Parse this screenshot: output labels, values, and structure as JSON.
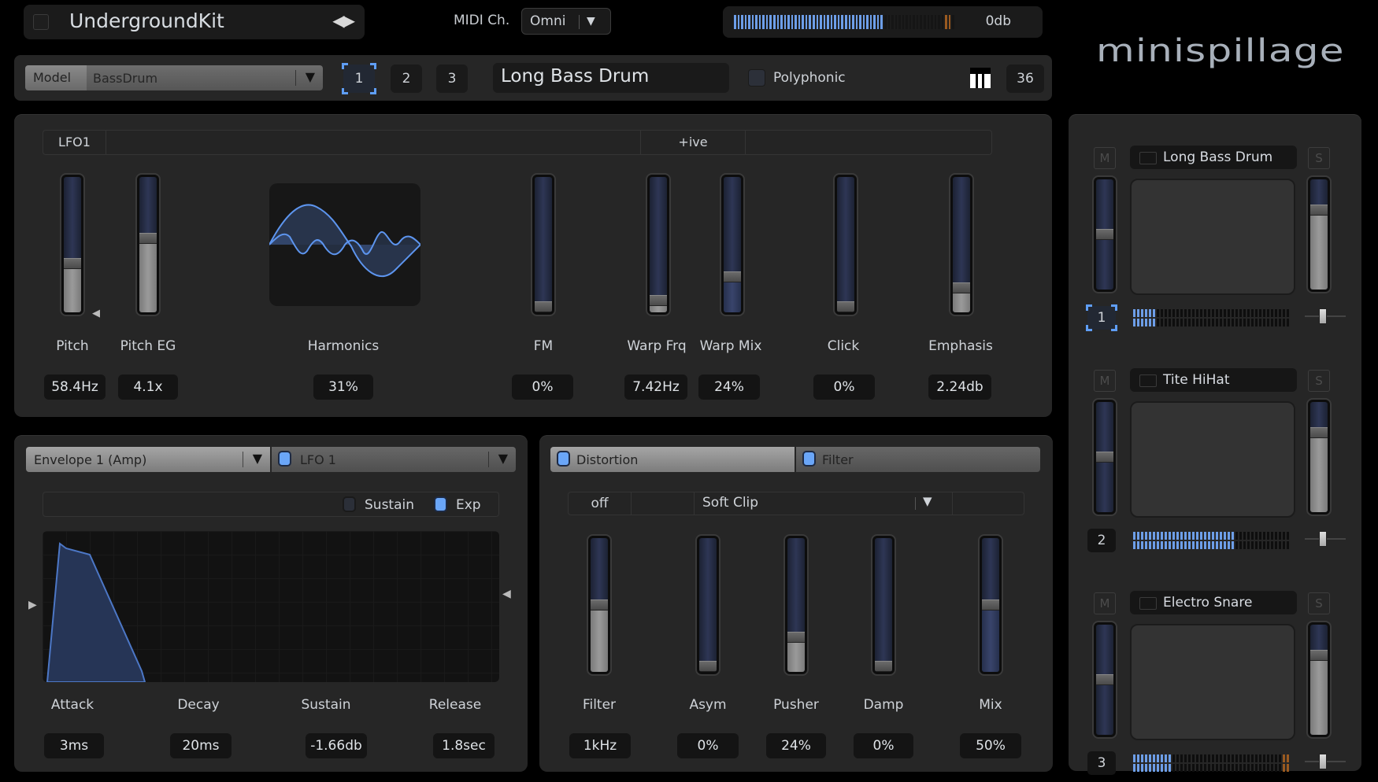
{
  "header": {
    "kit_name": "UndergroundKit",
    "kit_nav_icon": "left-right-arrows",
    "midi_label": "MIDI Ch.",
    "midi_channel": "Omni",
    "master_level": "0db",
    "master_meter_fraction": 0.68,
    "logo": "minispillage"
  },
  "sound": {
    "model_label": "Model",
    "model_value": "BassDrum",
    "slots": [
      "1",
      "2",
      "3"
    ],
    "selected_slot": "1",
    "name": "Long Bass Drum",
    "polyphonic_label": "Polyphonic",
    "polyphonic": false,
    "keyboard_icon": "piano-keys",
    "note": "36"
  },
  "modulation": {
    "source": "LFO1",
    "polarity": "+ive"
  },
  "controls": [
    {
      "label": "Pitch",
      "value": "58.4Hz",
      "level": 0.35
    },
    {
      "label": "Pitch EG",
      "value": "4.1x",
      "level": 0.55
    },
    {
      "label": "Harmonics",
      "value": "31%"
    },
    {
      "label": "FM",
      "value": "0%",
      "level": 0.0
    },
    {
      "label": "Warp Frq",
      "value": "7.42Hz",
      "level": 0.05
    },
    {
      "label": "Warp Mix",
      "value": "24%",
      "level": 0.24
    },
    {
      "label": "Click",
      "value": "0%",
      "level": 0.0
    },
    {
      "label": "Emphasis",
      "value": "2.24db",
      "level": 0.15
    }
  ],
  "envelope": {
    "selector": "Envelope 1 (Amp)",
    "lfo_label": "LFO 1",
    "lfo_enabled": true,
    "sustain_label": "Sustain",
    "sustain_enabled": false,
    "exp_label": "Exp",
    "exp_enabled": true,
    "params": [
      {
        "label": "Attack",
        "value": "3ms"
      },
      {
        "label": "Decay",
        "value": "20ms"
      },
      {
        "label": "Sustain",
        "value": "-1.66db"
      },
      {
        "label": "Release",
        "value": "1.8sec"
      }
    ]
  },
  "distortion": {
    "tab_label": "Distortion",
    "tab_enabled": true,
    "filter_tab_label": "Filter",
    "filter_tab_enabled": true,
    "off_label": "off",
    "mode": "Soft Clip",
    "params": [
      {
        "label": "Filter",
        "value": "1kHz",
        "level": 0.5
      },
      {
        "label": "Asym",
        "value": "0%",
        "level": 0.0
      },
      {
        "label": "Pusher",
        "value": "24%",
        "level": 0.24
      },
      {
        "label": "Damp",
        "value": "0%",
        "level": 0.0
      },
      {
        "label": "Mix",
        "value": "50%",
        "level": 0.5
      }
    ]
  },
  "mixer": {
    "mute_label": "M",
    "solo_label": "S",
    "channels": [
      {
        "num": "1",
        "name": "Long Bass Drum",
        "selected": true,
        "meter": 0.14,
        "volume": 0.75
      },
      {
        "num": "2",
        "name": "Tite HiHat",
        "selected": false,
        "meter": 0.65,
        "volume": 0.75
      },
      {
        "num": "3",
        "name": "Electro Snare",
        "selected": false,
        "meter": 0.24,
        "volume": 0.75
      }
    ]
  }
}
